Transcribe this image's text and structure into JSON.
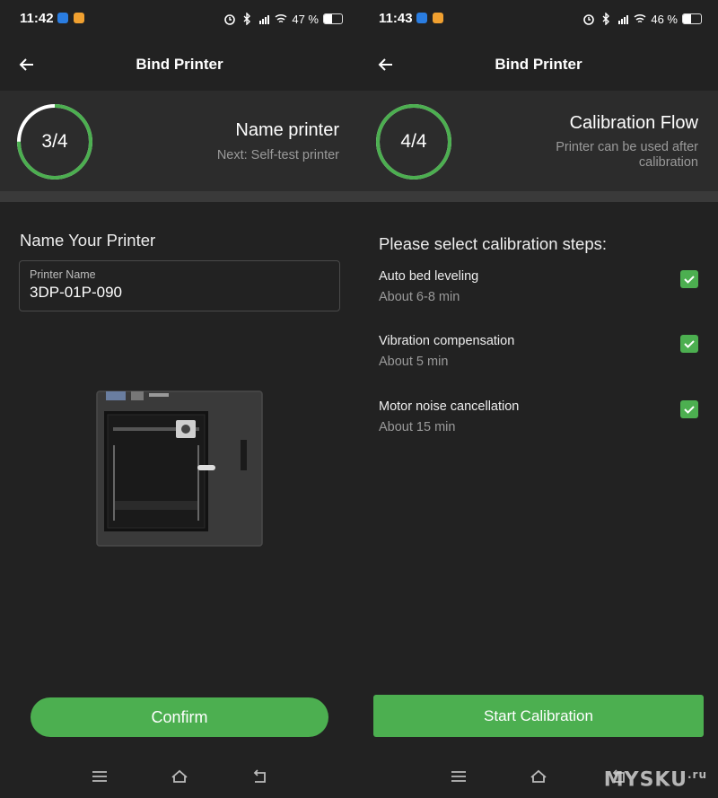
{
  "left": {
    "status": {
      "time": "11:42",
      "battery": "47 %",
      "battery_level": 0.47
    },
    "header": {
      "title": "Bind Printer"
    },
    "progress": {
      "label": "3/4",
      "fraction": 0.75,
      "title": "Name printer",
      "subtitle": "Next: Self-test printer"
    },
    "form": {
      "heading": "Name Your Printer",
      "field_label": "Printer Name",
      "field_value": "3DP-01P-090"
    },
    "confirm_label": "Confirm"
  },
  "right": {
    "status": {
      "time": "11:43",
      "battery": "46 %",
      "battery_level": 0.46
    },
    "header": {
      "title": "Bind Printer"
    },
    "progress": {
      "label": "4/4",
      "fraction": 1.0,
      "title": "Calibration Flow",
      "subtitle": "Printer can be used after calibration"
    },
    "heading": "Please select calibration steps:",
    "steps": [
      {
        "name": "Auto bed leveling",
        "time": "About 6-8 min",
        "checked": true
      },
      {
        "name": "Vibration compensation",
        "time": "About 5 min",
        "checked": true
      },
      {
        "name": "Motor noise cancellation",
        "time": "About 15 min",
        "checked": true
      }
    ],
    "start_label": "Start Calibration"
  },
  "watermark": {
    "text": "MYSKU",
    "suffix": ".ru"
  },
  "colors": {
    "accent": "#4caf50",
    "background": "#222222",
    "panel": "#2c2c2c"
  }
}
